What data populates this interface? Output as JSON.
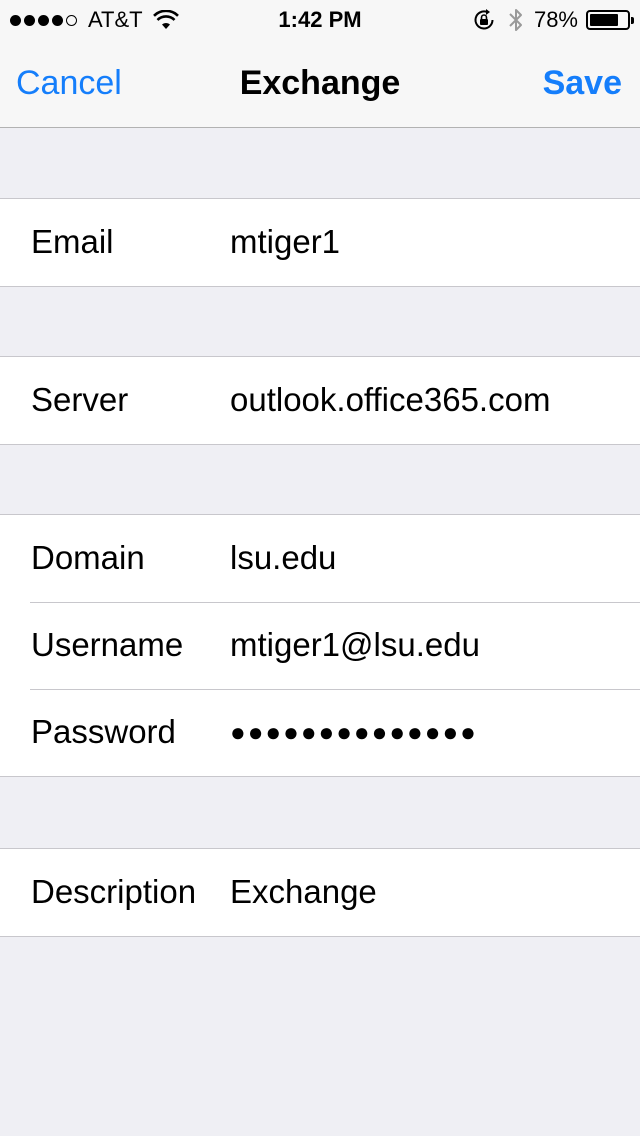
{
  "status_bar": {
    "carrier": "AT&T",
    "signal_bars": 4,
    "signal_total": 5,
    "time": "1:42 PM",
    "battery_percent": "78%",
    "battery_level": 0.78,
    "icons": [
      "wifi-icon",
      "rotation-lock-icon",
      "bluetooth-icon",
      "battery-icon"
    ]
  },
  "nav": {
    "cancel_label": "Cancel",
    "title": "Exchange",
    "save_label": "Save",
    "accent_color": "#157efb"
  },
  "form": {
    "email": {
      "label": "Email",
      "value": "mtiger1"
    },
    "server": {
      "label": "Server",
      "value": "outlook.office365.com"
    },
    "domain": {
      "label": "Domain",
      "value": "lsu.edu"
    },
    "username": {
      "label": "Username",
      "value": "mtiger1@lsu.edu"
    },
    "password": {
      "label": "Password",
      "value": "●●●●●●●●●●●●●●"
    },
    "description": {
      "label": "Description",
      "value": "Exchange"
    }
  }
}
